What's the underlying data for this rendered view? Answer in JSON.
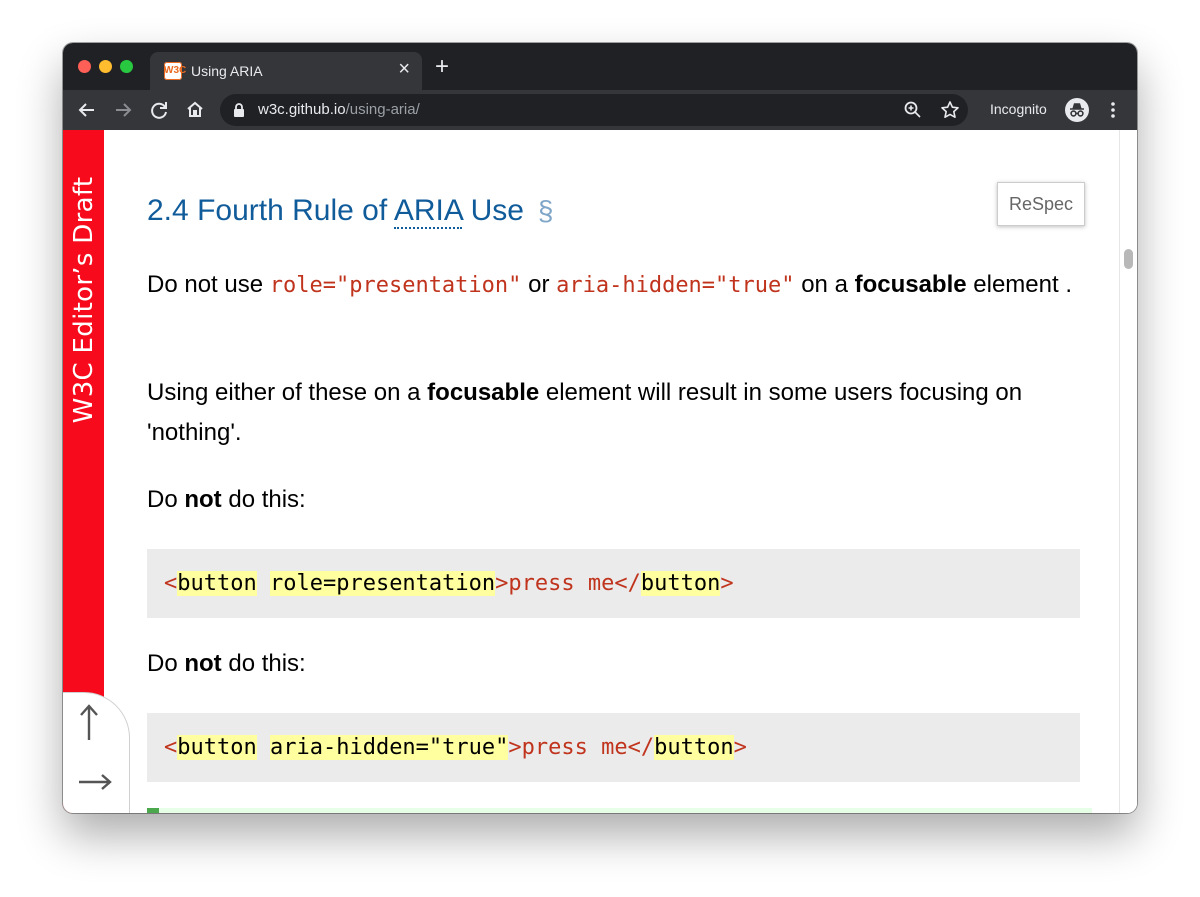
{
  "browser": {
    "tab": {
      "favicon_text": "W3C",
      "title": "Using ARIA"
    },
    "address": {
      "host": "w3c.github.io",
      "path": "/using-aria/"
    },
    "incognito_label": "Incognito"
  },
  "sidebar": {
    "label": "W3C Editor’s Draft"
  },
  "respec_button": "ReSpec",
  "section": {
    "heading_number": "2.4",
    "heading_pre": "Fourth Rule of",
    "heading_abbr": "ARIA",
    "heading_post": "Use",
    "self_link": "§"
  },
  "paragraph1": {
    "t1": "Do not use ",
    "code1": "role=\"presentation\"",
    "t2": " or ",
    "code2": "aria-hidden=\"true\"",
    "t3": " on a ",
    "strong": "focusable",
    "t4": " element ."
  },
  "paragraph2": {
    "t1": "Using either of these on a ",
    "strong": "focusable",
    "t2": " element will result in some users focusing on 'nothing'."
  },
  "dont1": {
    "pre": "Do ",
    "strong": "not",
    "post": " do this:"
  },
  "dont2": {
    "pre": "Do ",
    "strong": "not",
    "post": " do this:"
  },
  "example1": {
    "lt": "<",
    "tag": "button",
    "attr": "role=presentation",
    "gt": ">",
    "text": "press me",
    "close_open": "</",
    "close_tag": "button",
    "close_gt": ">"
  },
  "example2": {
    "lt": "<",
    "tag": "button",
    "attr": "aria-hidden=\"true\"",
    "gt": ">",
    "text": "press me",
    "close_open": "</",
    "close_tag": "button",
    "close_gt": ">"
  },
  "colors": {
    "sidebar_red": "#f60a1b",
    "heading_blue": "#105b9a",
    "code_red": "#c0341d",
    "highlight_yellow": "#ffff9f",
    "codeblock_bg": "#ebebeb"
  },
  "icons": [
    "back-arrow-icon",
    "forward-arrow-icon",
    "reload-icon",
    "home-icon",
    "lock-icon",
    "zoom-icon",
    "star-icon",
    "incognito-icon",
    "more-vert-icon",
    "arrow-up-icon",
    "arrow-right-icon"
  ]
}
